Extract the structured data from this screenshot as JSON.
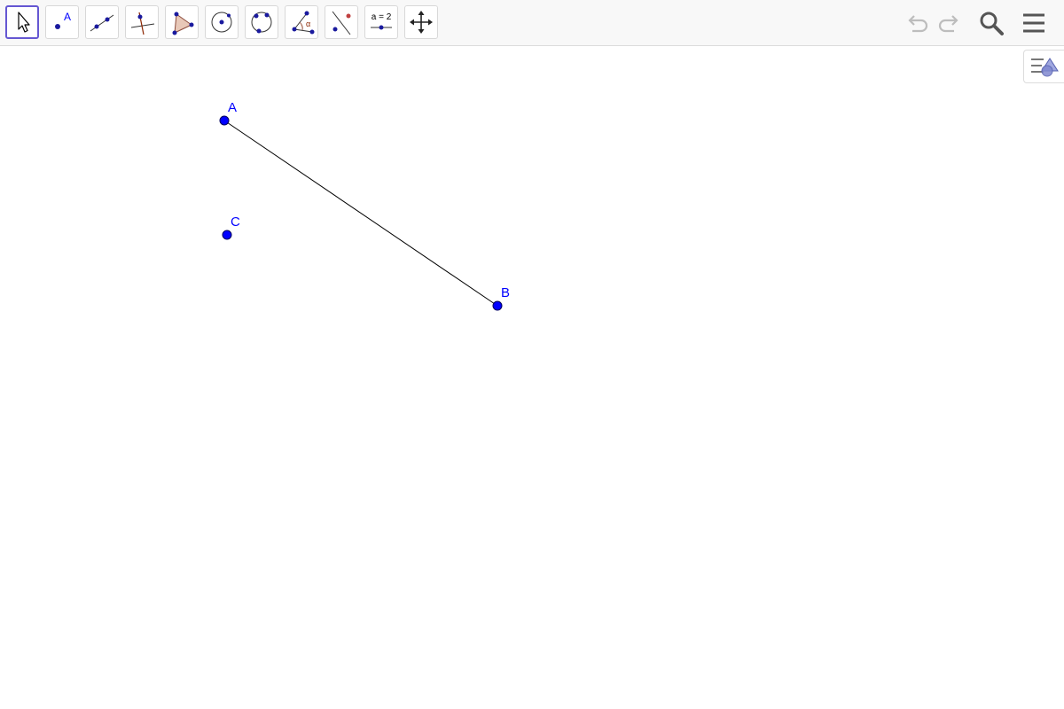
{
  "toolbar": {
    "tools": [
      {
        "icon": "move-arrow-icon",
        "active": true
      },
      {
        "icon": "point-icon",
        "label": "A"
      },
      {
        "icon": "line-through-two-points-icon"
      },
      {
        "icon": "perpendicular-line-icon"
      },
      {
        "icon": "polygon-icon"
      },
      {
        "icon": "circle-center-point-icon"
      },
      {
        "icon": "circle-three-points-icon"
      },
      {
        "icon": "angle-icon",
        "label": "α"
      },
      {
        "icon": "reflect-about-line-icon"
      },
      {
        "icon": "slider-icon",
        "label": "a = 2"
      },
      {
        "icon": "move-graphics-view-icon"
      }
    ],
    "right_controls": [
      "undo-icon",
      "redo-icon",
      "search-icon",
      "hamburger-menu-icon"
    ]
  },
  "construction": {
    "points": [
      {
        "label": "A",
        "color": "#0000ff"
      },
      {
        "label": "B",
        "color": "#0000ff"
      },
      {
        "label": "C",
        "color": "#0000ff"
      }
    ],
    "segments": [
      {
        "from": "A",
        "to": "B",
        "color": "#000000"
      }
    ]
  },
  "colors": {
    "accent": "#6557d2",
    "point_fill": "#0000ff",
    "segment": "#000000",
    "toolbar_bg": "#f8f8f8"
  }
}
